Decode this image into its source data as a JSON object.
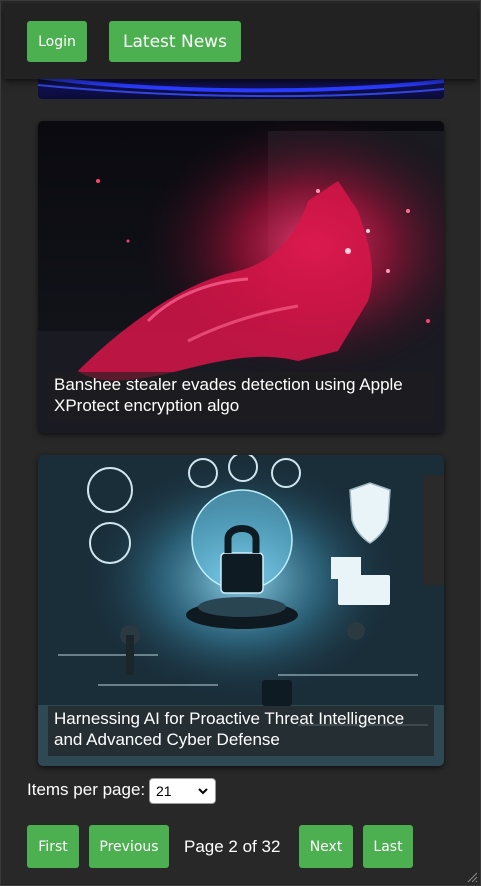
{
  "header": {
    "login_label": "Login",
    "latest_news_label": "Latest News"
  },
  "articles": [
    {
      "title": "Banshee stealer evades detection using Apple XProtect encryption algo",
      "image": "red-digital-hand-image"
    },
    {
      "title": "Harnessing AI for Proactive Threat Intelligence and Advanced Cyber Defense",
      "image": "cyber-padlock-image"
    }
  ],
  "items_per_page": {
    "label": "Items per page:",
    "selected": "21"
  },
  "pagination": {
    "first_label": "First",
    "previous_label": "Previous",
    "page_text": "Page 2 of 32",
    "next_label": "Next",
    "last_label": "Last"
  },
  "colors": {
    "accent": "#4caf50",
    "background": "#282828",
    "header": "#222222"
  }
}
